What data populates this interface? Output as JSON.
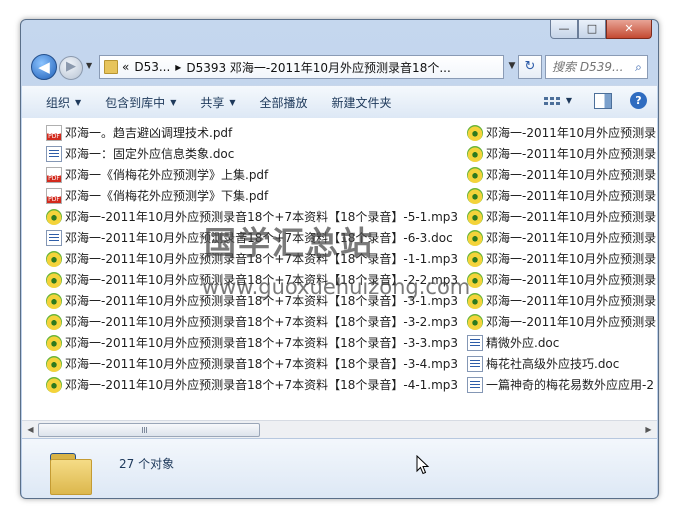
{
  "window": {
    "caption_buttons": [
      "—",
      "□",
      "✕"
    ]
  },
  "nav": {
    "back_glyph": "◀",
    "forward_glyph": "▶",
    "history_glyph": "▼",
    "address": {
      "overflow": "«",
      "crumbs": [
        "D53...",
        "D5393 邓海一-2011年10月外应预测录音18个..."
      ],
      "separator": "▸"
    },
    "refresh_glyph": "↻",
    "search_placeholder": "搜索 D539...",
    "search_icon": "search-icon"
  },
  "toolbar": {
    "organize": "组织",
    "include_library": "包含到库中",
    "share": "共享",
    "play_all": "全部播放",
    "new_folder": "新建文件夹",
    "dropdown_glyph": "▼",
    "help_glyph": "?"
  },
  "files": {
    "col1": [
      {
        "name": "邓海一。趋吉避凶调理技术.pdf",
        "type": "pdf"
      },
      {
        "name": "邓海一：固定外应信息类象.doc",
        "type": "doc"
      },
      {
        "name": "邓海一《俏梅花外应预测学》上集.pdf",
        "type": "pdf"
      },
      {
        "name": "邓海一《俏梅花外应预测学》下集.pdf",
        "type": "pdf"
      },
      {
        "name": "邓海一-2011年10月外应预测录音18个+7本资料【18个录音】-5-1.mp3",
        "type": "mp3"
      },
      {
        "name": "邓海一-2011年10月外应预测录音18个+7本资料【18个录音】-6-3.doc",
        "type": "doc"
      },
      {
        "name": "邓海一-2011年10月外应预测录音18个+7本资料【18个录音】-1-1.mp3",
        "type": "mp3"
      },
      {
        "name": "邓海一-2011年10月外应预测录音18个+7本资料【18个录音】-2-2.mp3",
        "type": "mp3"
      },
      {
        "name": "邓海一-2011年10月外应预测录音18个+7本资料【18个录音】-3-1.mp3",
        "type": "mp3"
      },
      {
        "name": "邓海一-2011年10月外应预测录音18个+7本资料【18个录音】-3-2.mp3",
        "type": "mp3"
      },
      {
        "name": "邓海一-2011年10月外应预测录音18个+7本资料【18个录音】-3-3.mp3",
        "type": "mp3"
      },
      {
        "name": "邓海一-2011年10月外应预测录音18个+7本资料【18个录音】-3-4.mp3",
        "type": "mp3"
      },
      {
        "name": "邓海一-2011年10月外应预测录音18个+7本资料【18个录音】-4-1.mp3",
        "type": "mp3"
      }
    ],
    "col2": [
      {
        "name": "邓海一-2011年10月外应预测录",
        "type": "mp3"
      },
      {
        "name": "邓海一-2011年10月外应预测录",
        "type": "mp3"
      },
      {
        "name": "邓海一-2011年10月外应预测录",
        "type": "mp3"
      },
      {
        "name": "邓海一-2011年10月外应预测录",
        "type": "mp3"
      },
      {
        "name": "邓海一-2011年10月外应预测录",
        "type": "mp3"
      },
      {
        "name": "邓海一-2011年10月外应预测录",
        "type": "mp3"
      },
      {
        "name": "邓海一-2011年10月外应预测录",
        "type": "mp3"
      },
      {
        "name": "邓海一-2011年10月外应预测录",
        "type": "mp3"
      },
      {
        "name": "邓海一-2011年10月外应预测录",
        "type": "mp3"
      },
      {
        "name": "邓海一-2011年10月外应预测录",
        "type": "mp3"
      },
      {
        "name": "精微外应.doc",
        "type": "doc"
      },
      {
        "name": "梅花社高级外应技巧.doc",
        "type": "doc"
      },
      {
        "name": "一篇神奇的梅花易数外应应用-2",
        "type": "doc"
      }
    ]
  },
  "scrollbar": {
    "left_glyph": "◀",
    "right_glyph": "▶",
    "grip": "|||"
  },
  "status": {
    "count": "27 个对象"
  },
  "watermark": {
    "cn": "国学汇总站",
    "url": "www.guoxuehuizong.com"
  }
}
